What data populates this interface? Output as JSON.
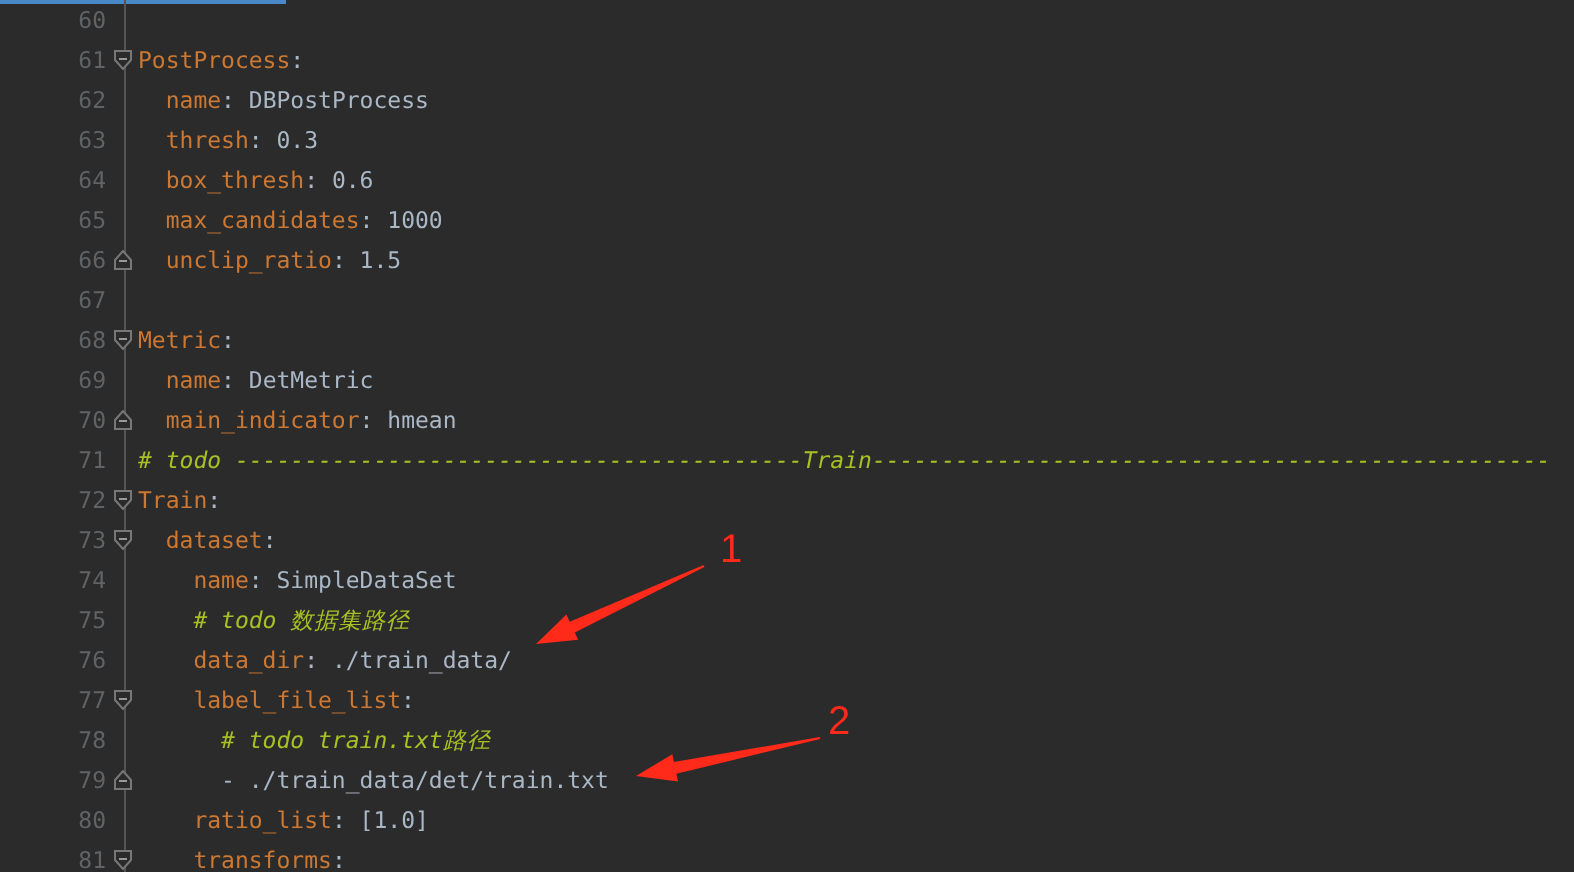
{
  "editor": {
    "lines": [
      {
        "number": "60",
        "fold_start": false,
        "fold_end": false
      },
      {
        "number": "61",
        "fold_start": true,
        "fold_end": false,
        "tokens": [
          {
            "kind": "key",
            "text": "PostProcess"
          },
          {
            "kind": "punct",
            "text": ":"
          }
        ],
        "children": [
          {
            "number": "62",
            "fold_start": false,
            "fold_end": false,
            "tokens": [
              {
                "kind": "key",
                "text": "name"
              },
              {
                "kind": "punct",
                "text": ":"
              },
              {
                "kind": "value",
                "text": " DBPostProcess"
              }
            ]
          },
          {
            "number": "63",
            "fold_start": false,
            "fold_end": false,
            "tokens": [
              {
                "kind": "key",
                "text": "thresh"
              },
              {
                "kind": "punct",
                "text": ":"
              },
              {
                "kind": "value",
                "text": " 0.3"
              }
            ]
          },
          {
            "number": "64",
            "fold_start": false,
            "fold_end": false,
            "tokens": [
              {
                "kind": "key",
                "text": "box_thresh"
              },
              {
                "kind": "punct",
                "text": ":"
              },
              {
                "kind": "value",
                "text": " 0.6"
              }
            ]
          },
          {
            "number": "65",
            "fold_start": false,
            "fold_end": false,
            "tokens": [
              {
                "kind": "key",
                "text": "max_candidates"
              },
              {
                "kind": "punct",
                "text": ":"
              },
              {
                "kind": "value",
                "text": " 1000"
              }
            ]
          },
          {
            "number": "66",
            "fold_start": false,
            "fold_end": true,
            "tokens": [
              {
                "kind": "key",
                "text": "unclip_ratio"
              },
              {
                "kind": "punct",
                "text": ":"
              },
              {
                "kind": "value",
                "text": " 1.5"
              }
            ]
          }
        ]
      },
      {
        "number": "67",
        "fold_start": false,
        "fold_end": false
      },
      {
        "number": "68",
        "fold_start": true,
        "fold_end": false,
        "tokens": [
          {
            "kind": "key",
            "text": "Metric"
          },
          {
            "kind": "punct",
            "text": ":"
          }
        ],
        "children": [
          {
            "number": "69",
            "fold_start": false,
            "fold_end": false,
            "tokens": [
              {
                "kind": "key",
                "text": "name"
              },
              {
                "kind": "punct",
                "text": ":"
              },
              {
                "kind": "value",
                "text": " DetMetric"
              }
            ]
          },
          {
            "number": "70",
            "fold_start": false,
            "fold_end": true,
            "tokens": [
              {
                "kind": "key",
                "text": "main_indicator"
              },
              {
                "kind": "punct",
                "text": ":"
              },
              {
                "kind": "value",
                "text": " hmean"
              }
            ]
          }
        ]
      },
      {
        "number": "71",
        "fold_start": false,
        "fold_end": false,
        "tokens": [
          {
            "kind": "comment",
            "text": "# todo -----------------------------------------Train-------------------------------------------------"
          }
        ]
      },
      {
        "number": "72",
        "fold_start": true,
        "fold_end": false,
        "tokens": [
          {
            "kind": "key",
            "text": "Train"
          },
          {
            "kind": "punct",
            "text": ":"
          }
        ],
        "children": [
          {
            "number": "73",
            "fold_start": true,
            "fold_end": false,
            "tokens": [
              {
                "kind": "key",
                "text": "dataset"
              },
              {
                "kind": "punct",
                "text": ":"
              }
            ],
            "children": [
              {
                "number": "74",
                "fold_start": false,
                "fold_end": false,
                "tokens": [
                  {
                    "kind": "key",
                    "text": "name"
                  },
                  {
                    "kind": "punct",
                    "text": ":"
                  },
                  {
                    "kind": "value",
                    "text": " SimpleDataSet"
                  }
                ]
              },
              {
                "number": "75",
                "fold_start": false,
                "fold_end": false,
                "tokens": [
                  {
                    "kind": "comment",
                    "text": "# todo 数据集路径"
                  }
                ]
              },
              {
                "number": "76",
                "fold_start": false,
                "fold_end": false,
                "tokens": [
                  {
                    "kind": "key",
                    "text": "data_dir"
                  },
                  {
                    "kind": "punct",
                    "text": ":"
                  },
                  {
                    "kind": "value",
                    "text": " ./train_data/"
                  }
                ]
              },
              {
                "number": "77",
                "fold_start": true,
                "fold_end": false,
                "tokens": [
                  {
                    "kind": "key",
                    "text": "label_file_list"
                  },
                  {
                    "kind": "punct",
                    "text": ":"
                  }
                ],
                "children": [
                  {
                    "number": "78",
                    "fold_start": false,
                    "fold_end": false,
                    "tokens": [
                      {
                        "kind": "comment",
                        "text": "# todo train.txt路径"
                      }
                    ]
                  },
                  {
                    "number": "79",
                    "fold_start": false,
                    "fold_end": true,
                    "tokens": [
                      {
                        "kind": "value",
                        "text": "- ./train_data/det/train.txt"
                      }
                    ]
                  }
                ]
              },
              {
                "number": "80",
                "fold_start": false,
                "fold_end": false,
                "tokens": [
                  {
                    "kind": "key",
                    "text": "ratio_list"
                  },
                  {
                    "kind": "punct",
                    "text": ":"
                  },
                  {
                    "kind": "value",
                    "text": " [1.0]"
                  }
                ]
              },
              {
                "number": "81",
                "fold_start": true,
                "fold_end": false,
                "tokens": [
                  {
                    "kind": "key",
                    "text": "transforms"
                  },
                  {
                    "kind": "punct",
                    "text": ":"
                  }
                ]
              }
            ]
          }
        ]
      }
    ]
  },
  "annotations": [
    {
      "label": "1"
    },
    {
      "label": "2"
    }
  ]
}
